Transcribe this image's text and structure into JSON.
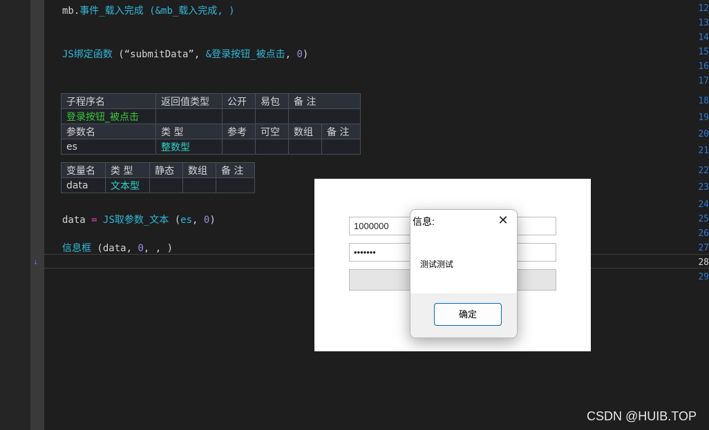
{
  "editor": {
    "line_numbers": [
      "12",
      "13",
      "14",
      "15",
      "16",
      "17",
      "18",
      "19",
      "20",
      "21",
      "22",
      "23",
      "24",
      "25",
      "26",
      "27",
      "28",
      "29"
    ],
    "line12": {
      "plain": "mb.",
      "call": "事件_载入完成",
      "args": " (&mb_载入完成, )"
    },
    "line15": {
      "call": "JS绑定函数",
      "args_open": " (“submitData”, ",
      "ref": "&登录按钮_被点击",
      "sep": ", ",
      "num": "0",
      "close": ")"
    },
    "line25": {
      "var": "data",
      "op": " = ",
      "call": "JS取参数_文本",
      "args_open": " (",
      "arg": "es",
      "sep": ", ",
      "num": "0",
      "close": ")"
    },
    "line27": {
      "call": "信息框",
      "args_open": " (data, ",
      "num": "0",
      "rest": ", , )"
    }
  },
  "sub_table": {
    "headers": [
      "子程序名",
      "返回值类型",
      "公开",
      "易包",
      "备 注"
    ],
    "name": "登录按钮_被点击",
    "param_headers": [
      "参数名",
      "类 型",
      "参考",
      "可空",
      "数组",
      "备 注"
    ],
    "param_name": "es",
    "param_type": "整数型"
  },
  "var_table": {
    "headers": [
      "变量名",
      "类 型",
      "静态",
      "数组",
      "备 注"
    ],
    "name": "data",
    "type": "文本型"
  },
  "preview": {
    "username_value": "1000000",
    "password_value": "•••••••"
  },
  "dialog": {
    "title": "信息:",
    "close_glyph": "✕",
    "message": "测试测试",
    "ok_label": "确定"
  },
  "watermark": "CSDN @HUIB.TOP"
}
